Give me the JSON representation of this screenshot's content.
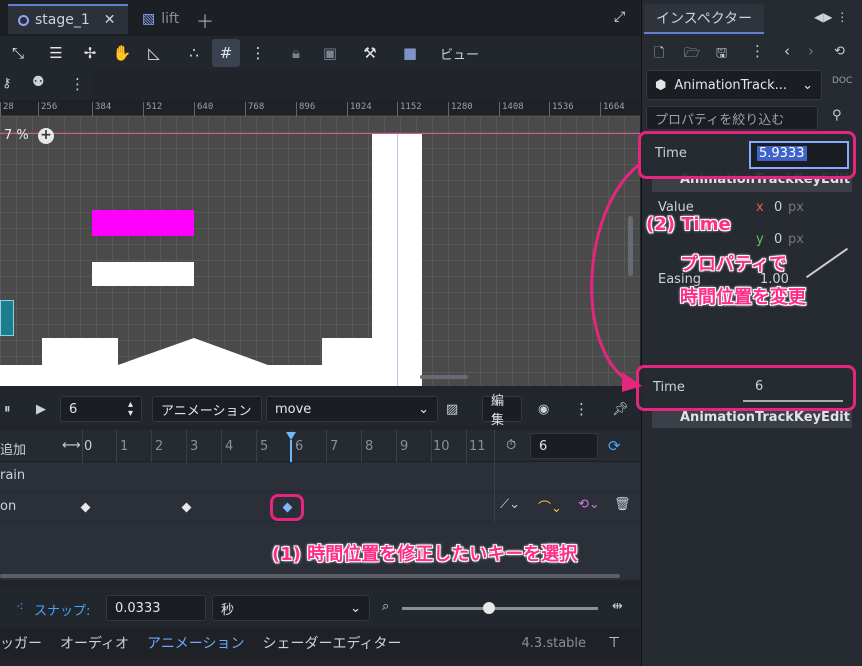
{
  "tabs": [
    {
      "label": "stage_1",
      "active": true
    },
    {
      "label": "lift",
      "active": false
    }
  ],
  "toolbar": {
    "view_label": "ビュー"
  },
  "ruler": {
    "ticks": [
      "28",
      "256",
      "384",
      "512",
      "640",
      "768",
      "896",
      "1024",
      "1152",
      "1280",
      "1408",
      "1536",
      "1664"
    ]
  },
  "viewport": {
    "zoom_label": "7 %"
  },
  "animation": {
    "step_value": "6",
    "animation_label": "アニメーション",
    "animation_name": "move",
    "edit_label": "編集"
  },
  "timeline": {
    "add_track_label": "追加",
    "marks": [
      "0",
      "1",
      "2",
      "3",
      "4",
      "5",
      "6",
      "7",
      "8",
      "9",
      "10",
      "11"
    ],
    "length_value": "6",
    "tracks": [
      "rain",
      "on"
    ]
  },
  "snap": {
    "label": "スナップ:",
    "value": "0.0333",
    "unit": "秒"
  },
  "bottom_tabs": [
    "ッガー",
    "オーディオ",
    "アニメーション",
    "シェーダーエディター"
  ],
  "version": "4.3.stable",
  "inspector": {
    "tab_label": "インスペクター",
    "object_name": "AnimationTrack...",
    "filter_placeholder": "プロパティを絞り込む",
    "time_label": "Time",
    "time_value_before": "5.9333",
    "section_title": "AnimationTrackKeyEdit",
    "value_label": "Value",
    "value_x_axis": "x",
    "value_x": "0",
    "value_y_axis": "y",
    "value_y": "0",
    "value_unit": "px",
    "easing_label": "Easing",
    "easing_value": "1.00",
    "time_value_after": "6"
  },
  "annotations": {
    "step1": "(1) 時間位置を修正したいキーを選択",
    "step2_line1": "(2) Time",
    "step2_line2": "プロパティで",
    "step2_line3": "時間位置を変更"
  },
  "colors": {
    "accent": "#e4267f",
    "editor_bg": "#21252b",
    "selection_blue": "#5f7fd1",
    "magenta_block": "#ff00ff"
  }
}
